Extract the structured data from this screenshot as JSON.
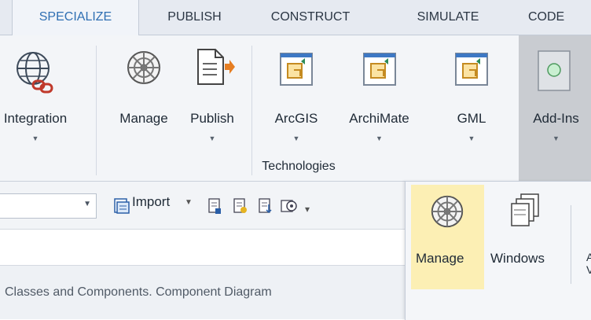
{
  "tabs": [
    {
      "label": "SPECIALIZE",
      "active": true
    },
    {
      "label": "PUBLISH",
      "active": false
    },
    {
      "label": "CONSTRUCT",
      "active": false
    },
    {
      "label": "SIMULATE",
      "active": false
    },
    {
      "label": "CODE",
      "active": false
    }
  ],
  "ribbon": {
    "integration_label": "Integration",
    "manage_label": "Manage",
    "publish_label": "Publish",
    "arcgis_label": "ArcGIS",
    "archimate_label": "ArchiMate",
    "gml_label": "GML",
    "addins_label": "Add-Ins",
    "group_label": "Technologies"
  },
  "toolbar": {
    "combo_value": "",
    "import_label": "Import"
  },
  "breadcrumb": "Classes and Components. Component Diagram",
  "popup": {
    "manage_label": "Manage",
    "windows_label": "Windows",
    "partial": "A V"
  },
  "colors": {
    "accent": "#2f6fb3",
    "hover": "#fcefb4",
    "ribbon_bg": "#f3f5f8"
  }
}
